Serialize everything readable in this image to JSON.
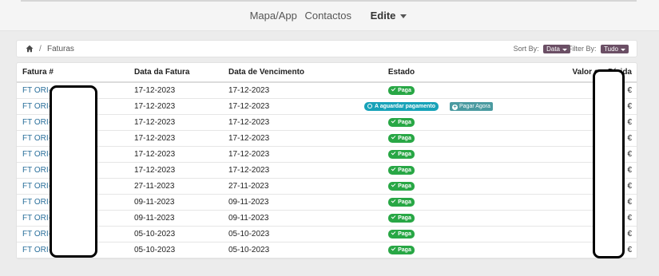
{
  "nav": {
    "links": [
      "Mapa/App",
      "Contactos"
    ],
    "dropdown_label": "Edite"
  },
  "breadcrumb": {
    "current": "Faturas",
    "separator": "/"
  },
  "controls": {
    "sort_label": "Sort By:",
    "sort_value": "Data",
    "filter_label": "Filter By:",
    "filter_value": "Tudo"
  },
  "table": {
    "headers": [
      "Fatura #",
      "Data da Fatura",
      "Data de Vencimento",
      "Estado",
      "",
      "Valor em Dívida"
    ],
    "rows": [
      {
        "invoice": "FT ORI-2",
        "date": "17-12-2023",
        "due": "17-12-2023",
        "status": "Paga",
        "action": "",
        "amount": "€"
      },
      {
        "invoice": "FT ORI-2",
        "date": "17-12-2023",
        "due": "17-12-2023",
        "status": "A aguardar pagamento",
        "action": "Pagar Agora",
        "amount": "€"
      },
      {
        "invoice": "FT ORI-2",
        "date": "17-12-2023",
        "due": "17-12-2023",
        "status": "Paga",
        "action": "",
        "amount": "€"
      },
      {
        "invoice": "FT ORI-2",
        "date": "17-12-2023",
        "due": "17-12-2023",
        "status": "Paga",
        "action": "",
        "amount": "€"
      },
      {
        "invoice": "FT ORI-2",
        "date": "17-12-2023",
        "due": "17-12-2023",
        "status": "Paga",
        "action": "",
        "amount": "€"
      },
      {
        "invoice": "FT ORI-2",
        "date": "17-12-2023",
        "due": "17-12-2023",
        "status": "Paga",
        "action": "",
        "amount": "€"
      },
      {
        "invoice": "FT ORI-2",
        "date": "27-11-2023",
        "due": "27-11-2023",
        "status": "Paga",
        "action": "",
        "amount": "€"
      },
      {
        "invoice": "FT ORI-2",
        "date": "09-11-2023",
        "due": "09-11-2023",
        "status": "Paga",
        "action": "",
        "amount": "€"
      },
      {
        "invoice": "FT ORI-2",
        "date": "09-11-2023",
        "due": "09-11-2023",
        "status": "Paga",
        "action": "",
        "amount": "€"
      },
      {
        "invoice": "FT ORI-2",
        "date": "05-10-2023",
        "due": "05-10-2023",
        "status": "Paga",
        "action": "",
        "amount": "€"
      },
      {
        "invoice": "FT ORI-2",
        "date": "05-10-2023",
        "due": "05-10-2023",
        "status": "Paga",
        "action": "",
        "amount": "€"
      }
    ]
  },
  "colors": {
    "paid": "#28a745",
    "waiting": "#17a2b8",
    "pay_button": "#4a9aa0",
    "link": "#2a6f9b",
    "dropdown": "#6b4f65"
  },
  "icons": {
    "breadcrumb_home": "home-icon",
    "paid": "check-icon",
    "waiting": "clock-icon",
    "pay": "plus-circle-icon"
  }
}
